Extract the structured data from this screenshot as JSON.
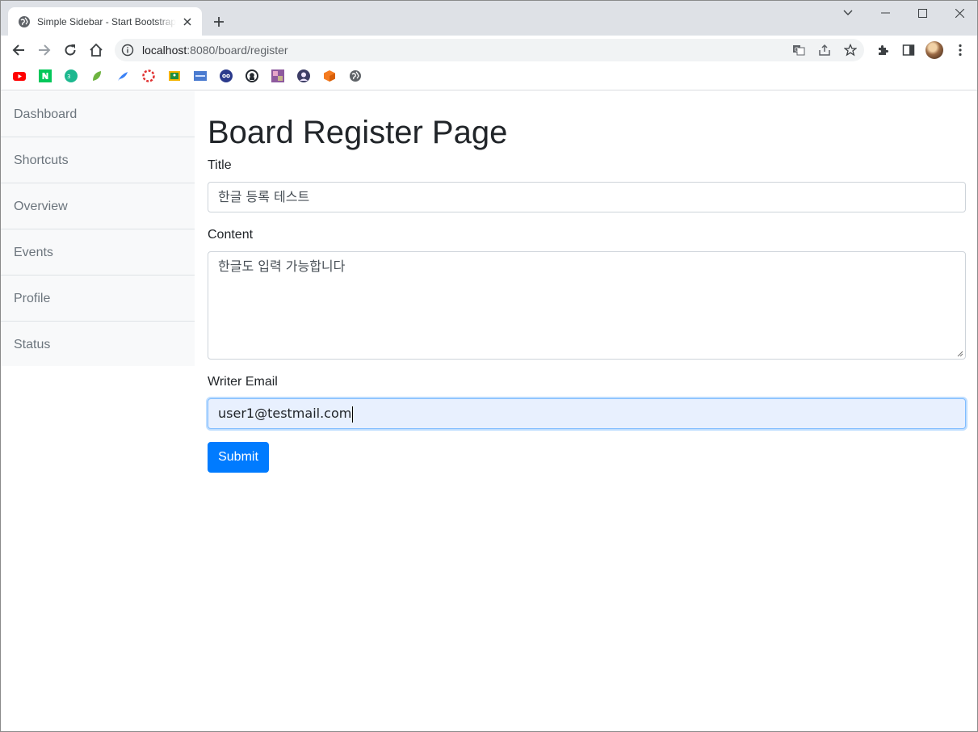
{
  "browser": {
    "tab_title": "Simple Sidebar - Start Bootstrap Template",
    "url_host": "localhost",
    "url_rest": ":8080/board/register",
    "bookmarks": [
      {
        "icon": "youtube-icon",
        "color": "#ff0000"
      },
      {
        "icon": "naver-icon",
        "color": "#03c75a"
      },
      {
        "icon": "bookmark-green-circle-icon",
        "color": "#1db88f"
      },
      {
        "icon": "leaf-icon",
        "color": "#6db33f"
      },
      {
        "icon": "feather-icon",
        "color": "#3b82f6"
      },
      {
        "icon": "lifebuoy-icon",
        "color": "#e03131"
      },
      {
        "icon": "classroom-icon",
        "color": "#f4b400"
      },
      {
        "icon": "bookmark-blue-box-icon",
        "color": "#4a7bd0"
      },
      {
        "icon": "owl-icon",
        "color": "#2b3a8c"
      },
      {
        "icon": "github-icon",
        "color": "#24292f"
      },
      {
        "icon": "photo-icon",
        "color": "#8e5a9e"
      },
      {
        "icon": "avatar-bookmark-icon",
        "color": "#3d3d66"
      },
      {
        "icon": "cube-icon",
        "color": "#f47b20"
      },
      {
        "icon": "globe-icon",
        "color": "#5f6368"
      }
    ]
  },
  "sidebar": {
    "items": [
      {
        "label": "Dashboard"
      },
      {
        "label": "Shortcuts"
      },
      {
        "label": "Overview"
      },
      {
        "label": "Events"
      },
      {
        "label": "Profile"
      },
      {
        "label": "Status"
      }
    ]
  },
  "page": {
    "heading": "Board Register Page",
    "title_label": "Title",
    "title_value": "한글 등록 테스트",
    "content_label": "Content",
    "content_value": "한글도 입력 가능합니다",
    "email_label": "Writer Email",
    "email_value": "user1@testmail.com",
    "submit_label": "Submit"
  },
  "colors": {
    "primary": "#007bff",
    "sidebar_bg": "#f8f9fa",
    "autofill_bg": "#e8f0fe"
  }
}
